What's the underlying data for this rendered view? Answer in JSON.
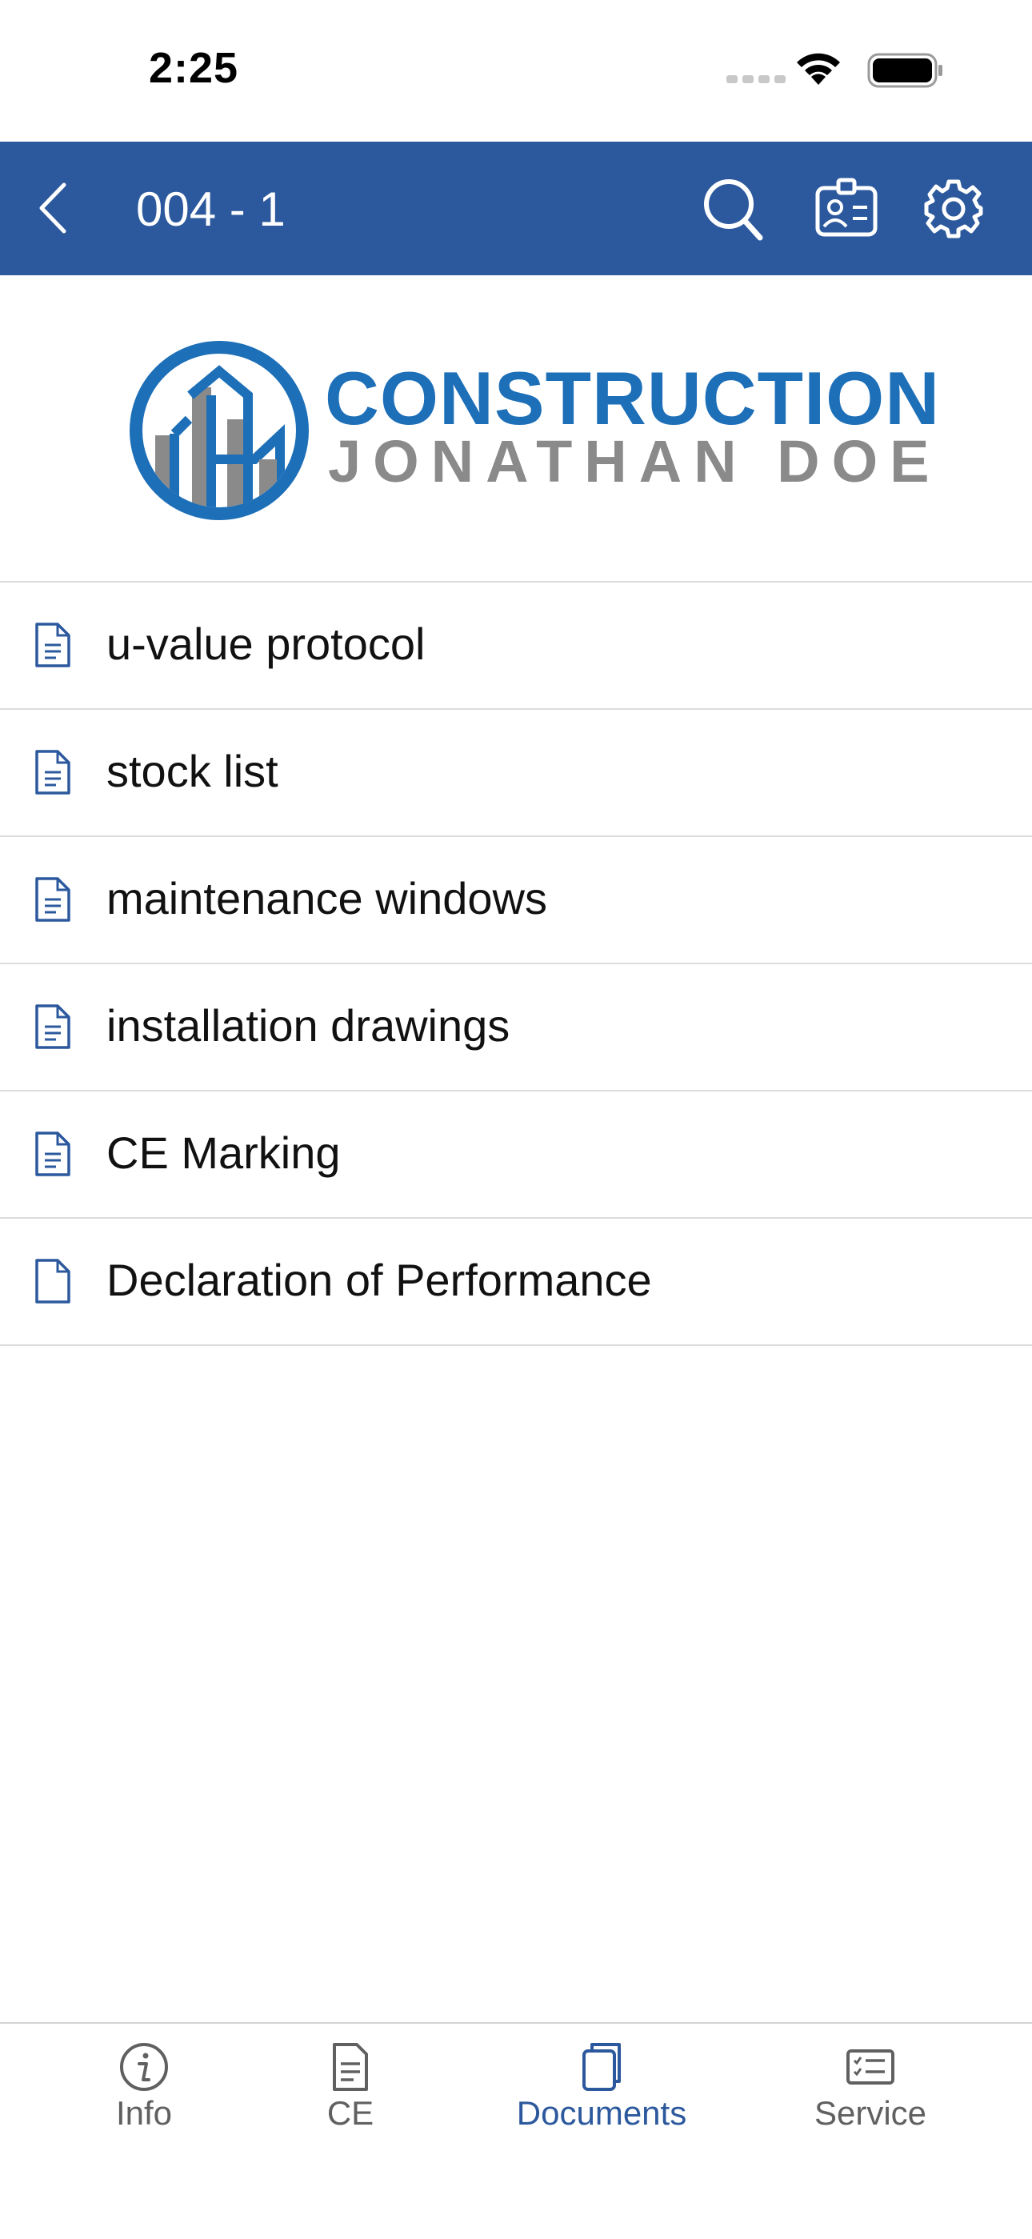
{
  "status_bar": {
    "time": "2:25"
  },
  "nav": {
    "title": "004 - 1",
    "back_icon": "chevron-left-icon",
    "actions": [
      "search-icon",
      "contact-card-icon",
      "gear-icon"
    ],
    "background_color": "#2c599d"
  },
  "logo": {
    "line1": "CONSTRUCTION",
    "line2": "JONATHAN DOE",
    "primary_color": "#1d6fb8",
    "secondary_color": "#8a8a8a"
  },
  "documents": [
    {
      "label": "u-value protocol",
      "icon": "document-lines-icon"
    },
    {
      "label": "stock list",
      "icon": "document-lines-icon"
    },
    {
      "label": "maintenance windows",
      "icon": "document-lines-icon"
    },
    {
      "label": "installation drawings",
      "icon": "document-lines-icon"
    },
    {
      "label": "CE Marking",
      "icon": "document-lines-icon"
    },
    {
      "label": "Declaration of Performance",
      "icon": "document-blank-icon"
    }
  ],
  "tabs": [
    {
      "label": "Info",
      "icon": "info-icon",
      "active": false
    },
    {
      "label": "CE",
      "icon": "document-icon",
      "active": false
    },
    {
      "label": "Documents",
      "icon": "documents-stack-icon",
      "active": true
    },
    {
      "label": "Service",
      "icon": "checklist-icon",
      "active": false
    }
  ]
}
